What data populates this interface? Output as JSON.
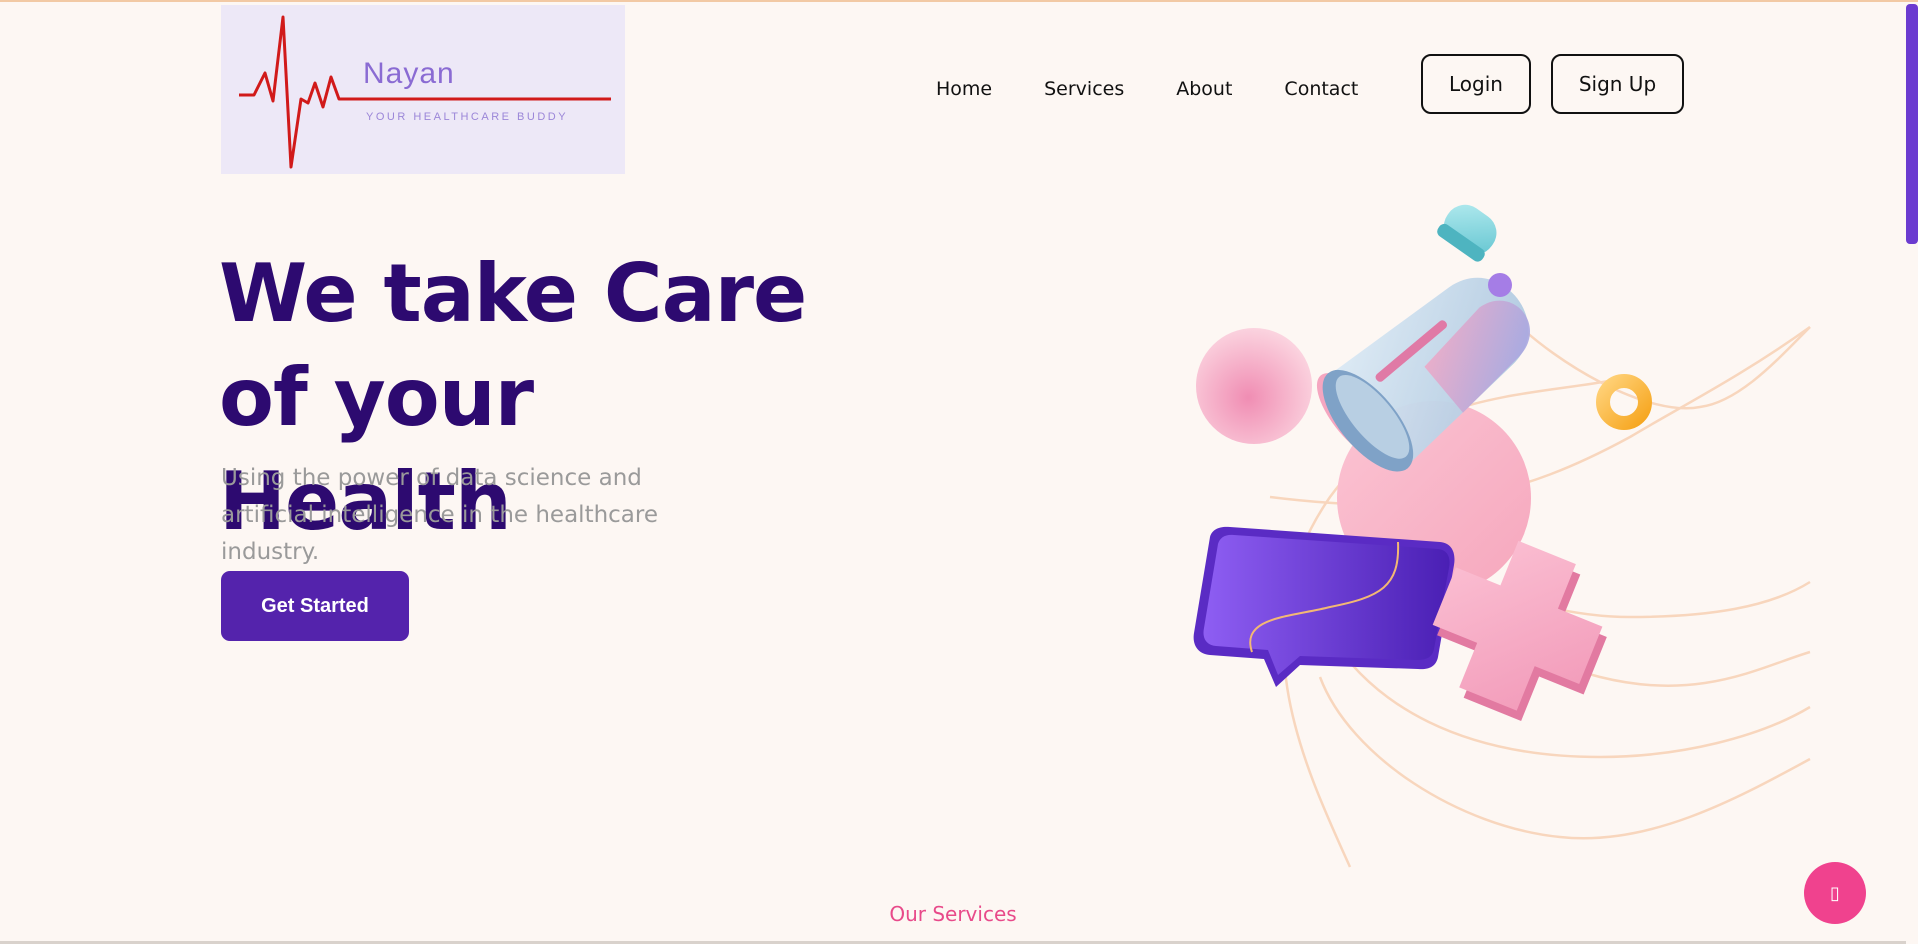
{
  "brand": {
    "name": "Nayan",
    "tagline": "YOUR HEALTHCARE BUDDY"
  },
  "nav": {
    "items": [
      {
        "label": "Home"
      },
      {
        "label": "Services"
      },
      {
        "label": "About"
      },
      {
        "label": "Contact"
      }
    ],
    "login_label": "Login",
    "signup_label": "Sign Up"
  },
  "hero": {
    "title_line1": "We take Care",
    "title_line2": "of your Health",
    "subtitle": "Using the power of data science and artificial intelligence in the healthcare industry.",
    "cta_label": "Get Started"
  },
  "services": {
    "label": "Our Services"
  },
  "chat": {
    "icon": "chat-icon",
    "glyph": "▯"
  },
  "colors": {
    "background": "#fdf7f3",
    "primary": "#5423ac",
    "heading": "#2d0a70",
    "accent_pink": "#f0428e",
    "logo_line": "#d11a1a"
  }
}
